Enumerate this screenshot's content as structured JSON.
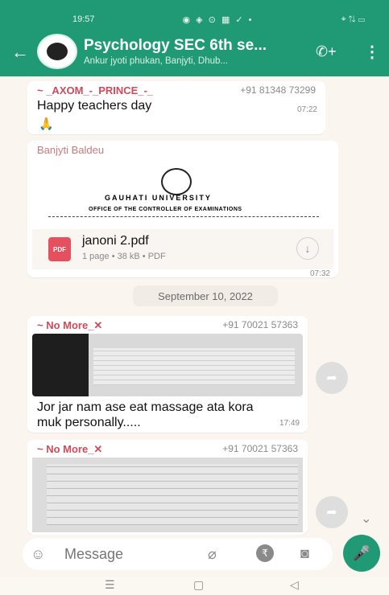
{
  "status": {
    "time": "19:57",
    "icons": "◉ ◈ ⊙ ▦ ✓ •",
    "right": "⌖ ⇅ ▭"
  },
  "header": {
    "back": "←",
    "title": "Psychology SEC 6th se...",
    "subtitle": "Ankur jyoti phukan, Banjyti, Dhub...",
    "call_icon": "✆+",
    "menu_icon": "⋮"
  },
  "messages": [
    {
      "sender": "~ _AXOM_-_PRINCE_-_",
      "phone": "+91 81348 73299",
      "text": "Happy teachers day",
      "emoji": "🙏",
      "time": "07:22"
    },
    {
      "sender": "Banjyti Baldeu",
      "doc_heading": "GAUHATI UNIVERSITY",
      "doc_sub": "OFFICE OF THE CONTROLLER OF EXAMINATIONS",
      "file_name": "janoni 2.pdf",
      "file_meta": "1 page • 38 kB • PDF",
      "file_type": "PDF",
      "time": "07:32"
    }
  ],
  "date_separator": "September 10, 2022",
  "messages2": [
    {
      "sender": "~ No More_✕",
      "phone": "+91 70021 57363",
      "text": "Jor jar nam ase eat massage ata kora muk personally.....",
      "time": "17:49"
    },
    {
      "sender": "~ No More_✕",
      "phone": "+91 70021 57363"
    }
  ],
  "input": {
    "placeholder": "Message"
  },
  "nav": {
    "recent": "☰",
    "home": "▢",
    "back": "◁"
  }
}
